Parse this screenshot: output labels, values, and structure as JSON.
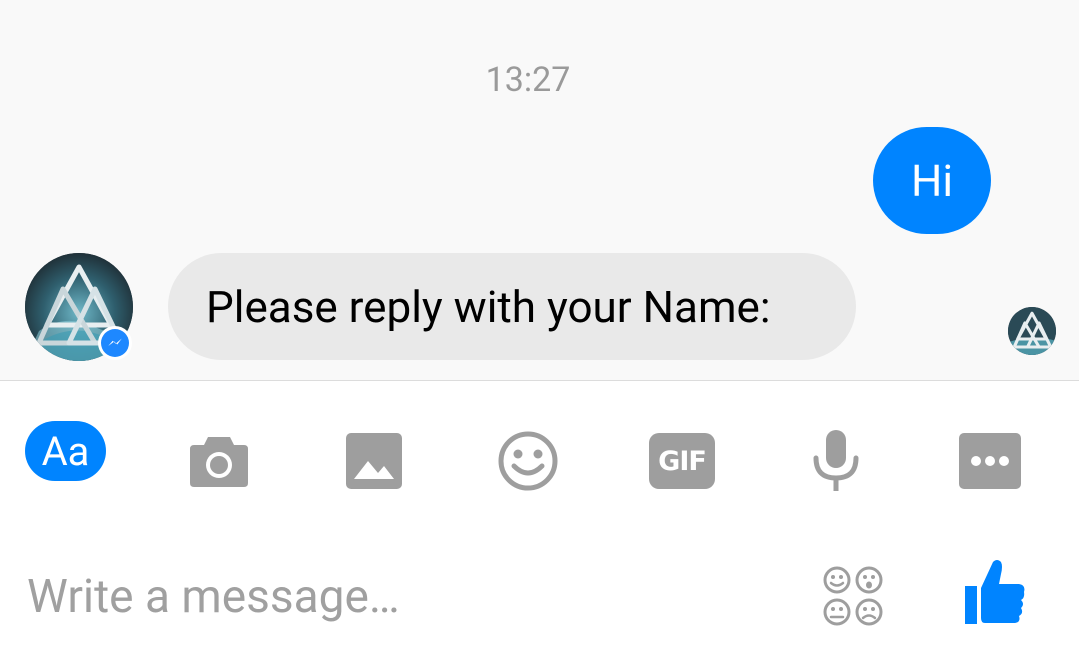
{
  "conversation": {
    "timestamp": "13:27",
    "messages": [
      {
        "direction": "outgoing",
        "text": "Hi"
      },
      {
        "direction": "incoming",
        "text": "Please reply with your Name:"
      }
    ]
  },
  "toolbar": {
    "text_mode_label": "Aa",
    "gif_label": "GIF",
    "items": [
      "text-mode",
      "camera",
      "gallery",
      "emoji",
      "gif",
      "microphone",
      "more"
    ]
  },
  "composer": {
    "placeholder": "Write a message…"
  },
  "colors": {
    "accent": "#0084ff",
    "icon_gray": "#9e9e9e",
    "incoming_bubble": "#e9e9e9",
    "background": "#f9f9f9"
  }
}
